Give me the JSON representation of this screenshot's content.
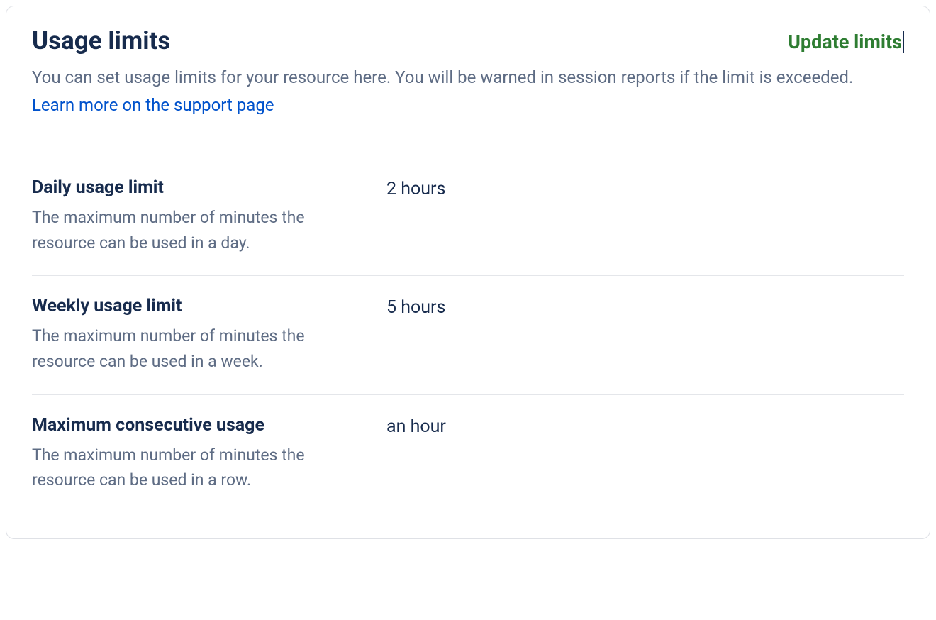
{
  "header": {
    "title": "Usage limits",
    "update_label": "Update limits",
    "description": "You can set usage limits for your resource here. You will be warned in session reports if the limit is exceeded.",
    "learn_more_label": "Learn more on the support page"
  },
  "limits": [
    {
      "title": "Daily usage limit",
      "description": "The maximum number of minutes the resource can be used in a day.",
      "value": "2 hours"
    },
    {
      "title": "Weekly usage limit",
      "description": "The maximum number of minutes the resource can be used in a week.",
      "value": "5 hours"
    },
    {
      "title": "Maximum consecutive usage",
      "description": "The maximum number of minutes the resource can be used in a row.",
      "value": "an hour"
    }
  ]
}
